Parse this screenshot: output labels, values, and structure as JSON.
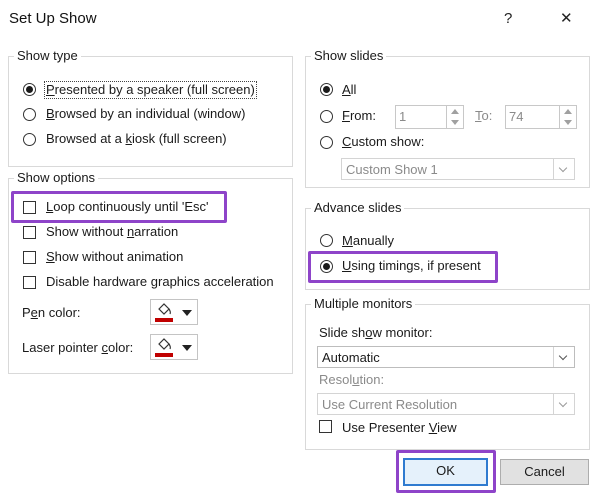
{
  "window": {
    "title": "Set Up Show",
    "help_label": "?",
    "close_label": "✕"
  },
  "show_type": {
    "label": "Show type",
    "options": [
      {
        "pre": "",
        "key": "P",
        "post": "resented by a speaker (full screen)",
        "selected": true
      },
      {
        "pre": "",
        "key": "B",
        "post": "rowsed by an individual (window)",
        "selected": false
      },
      {
        "pre": "Browsed at a ",
        "key": "k",
        "post": "iosk (full screen)",
        "selected": false
      }
    ]
  },
  "show_options": {
    "label": "Show options",
    "loop": {
      "pre": "",
      "key": "L",
      "post": "oop continuously until 'Esc'",
      "checked": false
    },
    "no_narration": {
      "pre": "Show without ",
      "key": "n",
      "post": "arration",
      "checked": false
    },
    "no_animation": {
      "pre": "",
      "key": "S",
      "post": "how without animation",
      "checked": false
    },
    "disable_hw": {
      "pre": "Disable hardware ",
      "key": "g",
      "post": "raphics acceleration",
      "checked": false
    },
    "pen_color": {
      "pre": "P",
      "key": "e",
      "post": "n color:"
    },
    "laser_color": {
      "pre": "Laser pointer ",
      "key": "c",
      "post": "olor:"
    }
  },
  "show_slides": {
    "label": "Show slides",
    "all": {
      "pre": "",
      "key": "A",
      "post": "ll",
      "selected": true
    },
    "from": {
      "pre": "",
      "key": "F",
      "post": "rom:",
      "selected": false,
      "value": "1"
    },
    "to": {
      "pre": "",
      "key": "T",
      "post": "o:",
      "value": "74"
    },
    "custom": {
      "pre": "",
      "key": "C",
      "post": "ustom show:",
      "selected": false
    },
    "custom_value": "Custom Show 1"
  },
  "advance_slides": {
    "label": "Advance slides",
    "manually": {
      "pre": "",
      "key": "M",
      "post": "anually",
      "selected": false
    },
    "timings": {
      "pre": "",
      "key": "U",
      "post": "sing timings, if present",
      "selected": true
    }
  },
  "multiple_monitors": {
    "label": "Multiple monitors",
    "monitor_label": {
      "pre": "Slide sh",
      "key": "o",
      "post": "w monitor:"
    },
    "monitor_value": "Automatic",
    "resolution_label": {
      "pre": "Resol",
      "key": "u",
      "post": "tion:"
    },
    "resolution_value": "Use Current Resolution",
    "presenter": {
      "pre": "Use Presenter ",
      "key": "V",
      "post": "iew",
      "checked": false
    }
  },
  "buttons": {
    "ok": "OK",
    "cancel": "Cancel"
  },
  "colors": {
    "highlight": "#8e44c9",
    "pen": "#c00000",
    "default_button_border": "#2f7bd0"
  }
}
